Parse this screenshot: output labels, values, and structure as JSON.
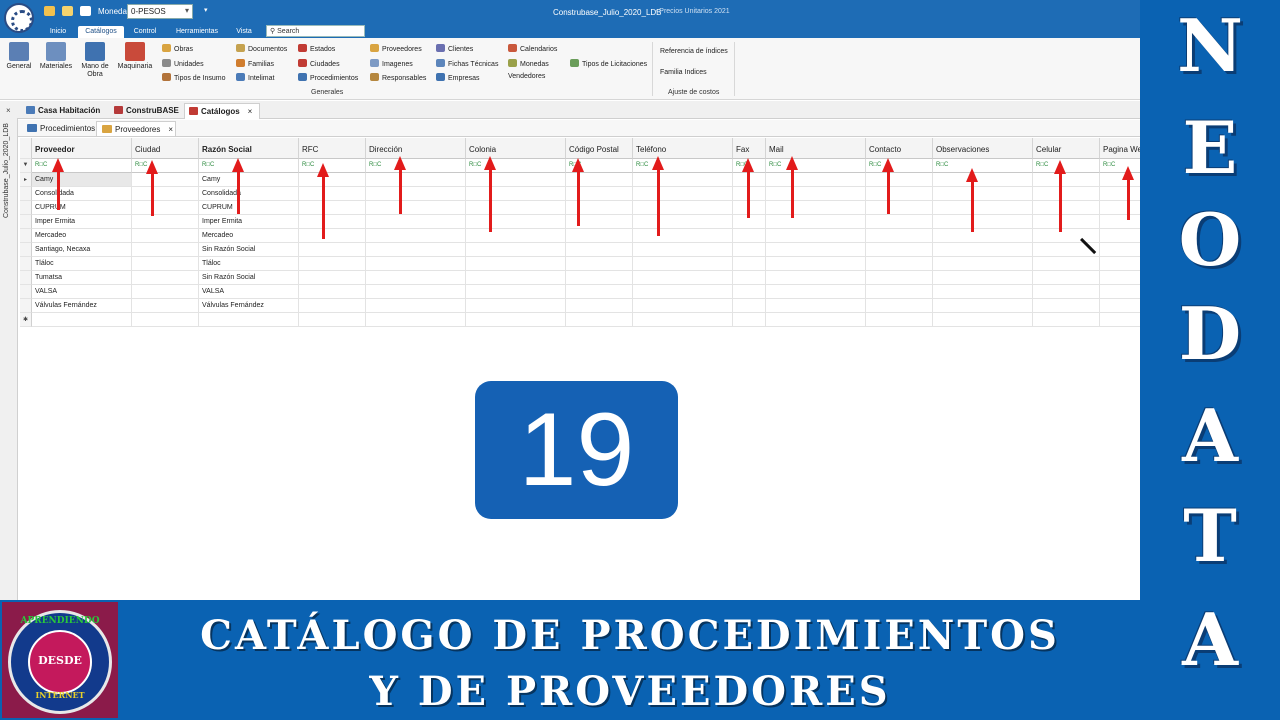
{
  "window": {
    "title": "Construbase_Julio_2020_LDB",
    "subtitle": "- Precios Unitarios 2021",
    "currency_label": "Moneda",
    "currency_value": "0-PESOS",
    "dropdown_glyph": "▾"
  },
  "ribbon_tabs": [
    "Inicio",
    "Catálogos",
    "Control",
    "Herramientas",
    "Vista"
  ],
  "search": {
    "placeholder": "Search",
    "icon": "search-icon"
  },
  "ribbon": {
    "big_buttons": [
      {
        "label": "General",
        "icon": "general-icon",
        "color": "#5b7fb4"
      },
      {
        "label": "Materiales",
        "icon": "materials-icon",
        "color": "#6d8fbf"
      },
      {
        "label": "Mano de Obra",
        "icon": "labor-icon",
        "color": "#3f72b0"
      },
      {
        "label": "Maquinaria",
        "icon": "machinery-icon",
        "color": "#c94a3a"
      }
    ],
    "col1": [
      "Obras",
      "Unidades",
      "Tipos de Insumo"
    ],
    "col2": [
      "Documentos",
      "Familias",
      "Intelimat"
    ],
    "col3": [
      "Estados",
      "Ciudades",
      "Procedimientos"
    ],
    "col4": [
      "Proveedores",
      "Imagenes",
      "Responsables"
    ],
    "col5": [
      "Clientes",
      "Fichas Técnicas",
      "Empresas"
    ],
    "col6": [
      "Calendarios",
      "Monedas",
      "Vendedores"
    ],
    "col7": [
      "Tipos de Licitaciones"
    ],
    "generales_label": "Generales",
    "right_items": [
      "Referencia de índices",
      "Familia Indices"
    ],
    "ajuste_label": "Ajuste de costos"
  },
  "doc_tabs": [
    "Casa Habitación",
    "ConstruBASE",
    "Catálogos"
  ],
  "sub_tabs": [
    "Procedimientos",
    "Proveedores"
  ],
  "sidebar_label": "Construbase_Julio_2020_LDB",
  "close_glyph": "×",
  "grid": {
    "columns": [
      "Proveedor",
      "Ciudad",
      "Razón Social",
      "RFC",
      "Dirección",
      "Colonia",
      "Código Postal",
      "Teléfono",
      "Fax",
      "Mail",
      "Contacto",
      "Observaciones",
      "Celular",
      "Pagina Web"
    ],
    "bold_columns": [
      0,
      2
    ],
    "filter_glyph": "R□C",
    "filter_row_marker": "▼",
    "current_row_marker": "▸",
    "new_row_marker": "✱",
    "rows": [
      [
        "Camy",
        "",
        "Camy"
      ],
      [
        "Consolidada",
        "",
        "Consolidada"
      ],
      [
        "CUPRUM",
        "",
        "CUPRUM"
      ],
      [
        "Imper Ermita",
        "",
        "Imper Ermita"
      ],
      [
        "Mercadeo",
        "",
        "Mercadeo"
      ],
      [
        "Santiago, Necaxa",
        "",
        "Sin Razón Social"
      ],
      [
        "Tláloc",
        "",
        "Tláloc"
      ],
      [
        "Tumatsa",
        "",
        "Sin Razón Social"
      ],
      [
        "VALSA",
        "",
        "VALSA"
      ],
      [
        "Válvulas Fernández",
        "",
        "Válvulas Fernández"
      ]
    ]
  },
  "overlay": {
    "number": "19",
    "side_letters": [
      "N",
      "E",
      "O",
      "D",
      "A",
      "T",
      "A"
    ],
    "banner_line1": "CATÁLOGO DE PROCEDIMIENTOS",
    "banner_line2": "Y DE PROVEEDORES",
    "seal_top": "APRENDIENDO",
    "seal_mid": "DESDE",
    "seal_bot": "INTERNET"
  },
  "colors": {
    "brand_blue": "#0a62b2",
    "titlebar_blue": "#1e6cb5",
    "arrow_red": "#e21b1b"
  }
}
